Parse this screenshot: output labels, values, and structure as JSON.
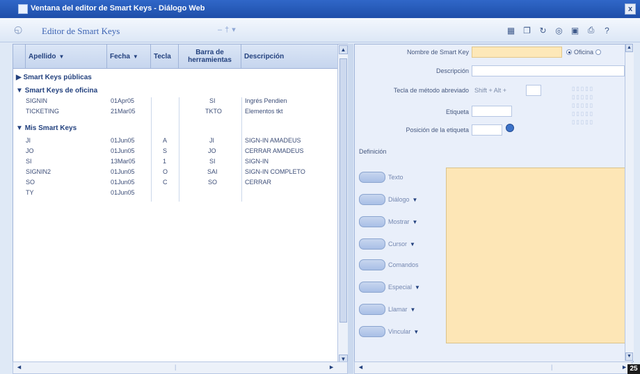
{
  "window": {
    "title": "Ventana del editor de Smart Keys - Diálogo Web",
    "close_label": "x"
  },
  "header": {
    "title": "Editor de Smart Keys",
    "toolbar_icons": [
      "export-icon",
      "copy-icon",
      "refresh-icon",
      "settings-icon",
      "save-icon",
      "print-icon",
      "help-icon"
    ]
  },
  "list": {
    "columns": [
      {
        "label": "Apellido",
        "sort": "▼"
      },
      {
        "label": "Fecha",
        "sort": "▼"
      },
      {
        "label": "Tecla",
        "sort": ""
      },
      {
        "label": "Barra de herramientas",
        "sort": ""
      },
      {
        "label": "Descripción",
        "sort": ""
      }
    ],
    "groups": [
      {
        "label": "Smart Keys públicas",
        "expanded": false,
        "rows": []
      },
      {
        "label": "Smart Keys de oficina",
        "expanded": true,
        "rows": [
          {
            "name": "SIGNIN",
            "date": "01Apr05",
            "key": "",
            "toolbar": "SI",
            "desc": "Ingrés Pendien"
          },
          {
            "name": "TICKETING",
            "date": "21Mar05",
            "key": "",
            "toolbar": "TKTO",
            "desc": "Elementos tkt"
          }
        ]
      },
      {
        "label": "Mis Smart Keys",
        "expanded": true,
        "rows": [
          {
            "name": "JI",
            "date": "01Jun05",
            "key": "A",
            "toolbar": "JI",
            "desc": "SIGN-IN AMADEUS"
          },
          {
            "name": "JO",
            "date": "01Jun05",
            "key": "S",
            "toolbar": "JO",
            "desc": "CERRAR AMADEUS"
          },
          {
            "name": "SI",
            "date": "13Mar05",
            "key": "1",
            "toolbar": "SI",
            "desc": "SIGN-IN"
          },
          {
            "name": "SIGNIN2",
            "date": "01Jun05",
            "key": "O",
            "toolbar": "SAI",
            "desc": "SIGN-IN COMPLETO"
          },
          {
            "name": "SO",
            "date": "01Jun05",
            "key": "C",
            "toolbar": "SO",
            "desc": "CERRAR"
          },
          {
            "name": "TY",
            "date": "01Jun05",
            "key": "",
            "toolbar": "",
            "desc": ""
          }
        ]
      }
    ]
  },
  "form": {
    "name_label": "Nombre de Smart Key",
    "name_value": "",
    "scope_option1": "Oficina",
    "scope_option2": "",
    "desc_label": "Descripción",
    "desc_value": "",
    "shortcut_label": "Tecla de método abreviado",
    "shortcut_value": "Shift + Alt +",
    "label_label": "Etiqueta",
    "label_value": "",
    "labelpos_label": "Posición de la etiqueta",
    "labelpos_value": "",
    "definition_label": "Definición",
    "definition_buttons": [
      {
        "label": "Texto",
        "dropdown": ""
      },
      {
        "label": "Diálogo",
        "dropdown": "▼"
      },
      {
        "label": "Mostrar",
        "dropdown": "▼"
      },
      {
        "label": "Cursor",
        "dropdown": "▼"
      },
      {
        "label": "Comandos",
        "dropdown": ""
      },
      {
        "label": "Especial",
        "dropdown": "▼"
      },
      {
        "label": "Llamar",
        "dropdown": "▼"
      },
      {
        "label": "Vincular",
        "dropdown": "▼"
      }
    ]
  },
  "badge": "25"
}
